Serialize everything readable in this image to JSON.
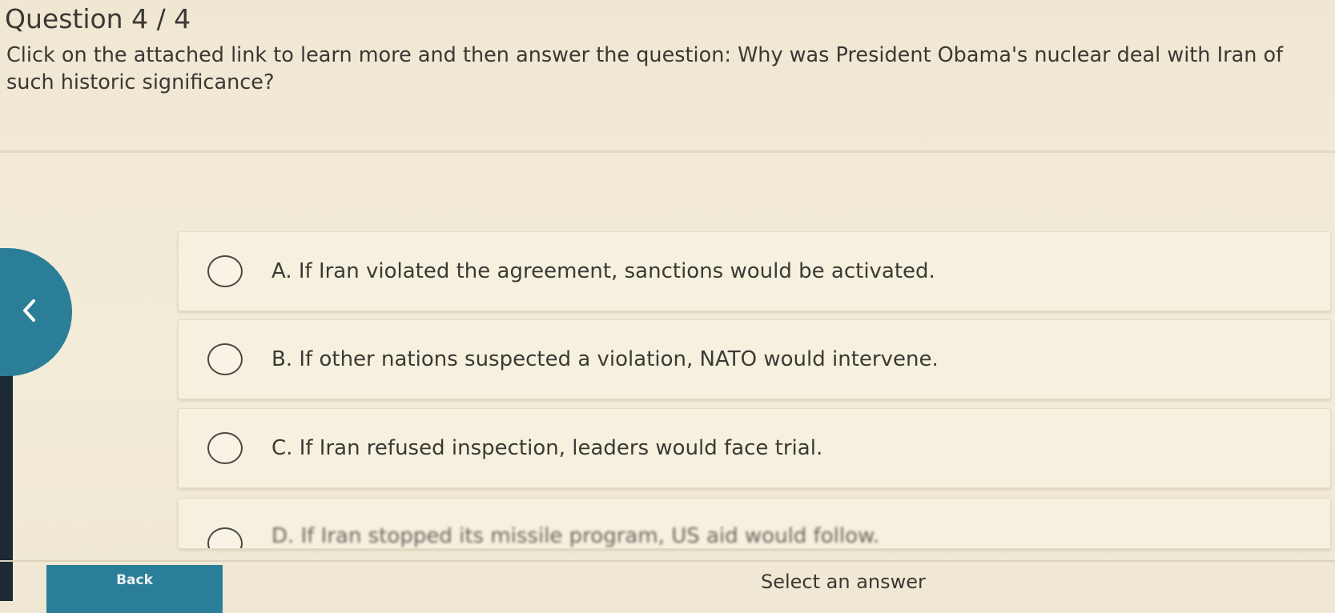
{
  "header": {
    "question_number": "Question 4 / 4",
    "question_text": "Click on the attached link to learn more and then answer the question: Why was President Obama's nuclear deal with Iran of such historic significance?"
  },
  "options": [
    {
      "letter": "A.",
      "text": "If Iran violated the agreement, sanctions would be activated."
    },
    {
      "letter": "B.",
      "text": "If other nations suspected a violation, NATO would intervene."
    },
    {
      "letter": "C.",
      "text": "If Iran refused inspection, leaders would face trial."
    },
    {
      "letter": "D.",
      "text": "If Iran stopped its missile program, US aid would follow."
    }
  ],
  "footer": {
    "back_label": "Back",
    "status_text": "Select an answer"
  },
  "icons": {
    "prev": "chevron-left-icon",
    "radio": "radio-circle-icon"
  },
  "colors": {
    "accent": "#2b7e97",
    "background": "#f2ead7"
  }
}
